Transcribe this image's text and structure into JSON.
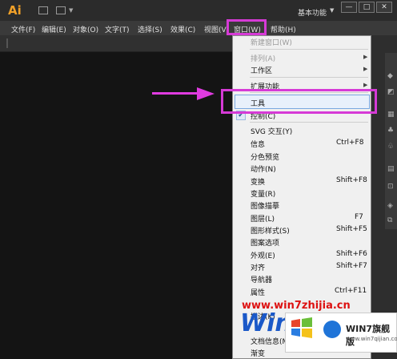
{
  "app": {
    "logo": "Ai",
    "workspace": "基本功能"
  },
  "window_buttons": {
    "minimize": "—",
    "restore": "□",
    "close": "✕"
  },
  "menubar": [
    {
      "label": "文件(F)"
    },
    {
      "label": "编辑(E)"
    },
    {
      "label": "对象(O)"
    },
    {
      "label": "文字(T)"
    },
    {
      "label": "选择(S)"
    },
    {
      "label": "效果(C)"
    },
    {
      "label": "视图(V"
    },
    {
      "label": "窗口(W)"
    },
    {
      "label": "帮助(H)"
    }
  ],
  "dropdown": {
    "items": [
      {
        "label": "新建窗口(W)",
        "disabled": true
      },
      {
        "label": "排列(A)",
        "disabled": true,
        "submenu": true
      },
      {
        "label": "工作区",
        "submenu": true
      },
      {
        "label": "扩展功能",
        "submenu": true
      },
      {
        "label": "工具",
        "highlighted": true
      },
      {
        "label": "控制(C)",
        "checked": true
      },
      {
        "label": "SVG 交互(Y)"
      },
      {
        "label": "信息",
        "shortcut": "Ctrl+F8"
      },
      {
        "label": "分色预览"
      },
      {
        "label": "动作(N)"
      },
      {
        "label": "变换",
        "shortcut": "Shift+F8"
      },
      {
        "label": "变量(R)"
      },
      {
        "label": "图像描摹"
      },
      {
        "label": "图层(L)",
        "shortcut": "F7"
      },
      {
        "label": "图形样式(S)",
        "shortcut": "Shift+F5"
      },
      {
        "label": "图案选项"
      },
      {
        "label": "外观(E)",
        "shortcut": "Shift+F6"
      },
      {
        "label": "对齐",
        "shortcut": "Shift+F7"
      },
      {
        "label": "导航器"
      },
      {
        "label": "属性",
        "shortcut": "Ctrl+F11"
      },
      {
        "label": "描边(K)"
      },
      {
        "label": "文档信息(M)"
      },
      {
        "label": "渐变"
      }
    ]
  },
  "watermark": {
    "url": "www.win7zhijia.cn",
    "logo": "Win",
    "name": "WIN7旗舰版",
    "site": "www.win7qijian.com"
  },
  "colors": {
    "highlight_frame": "#d63ad6",
    "arrow": "#e03be0",
    "logo": "#f0a028"
  }
}
